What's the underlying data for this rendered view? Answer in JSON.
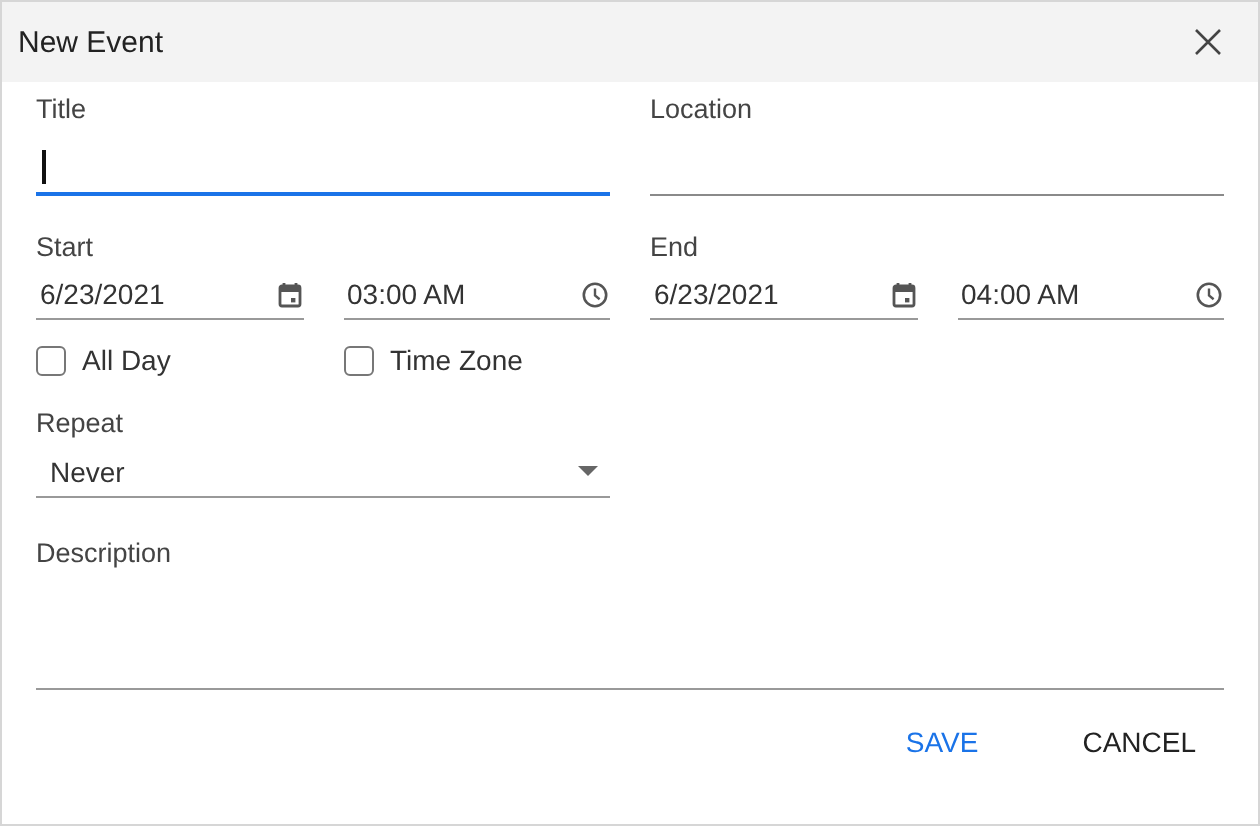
{
  "dialog": {
    "title": "New Event"
  },
  "title_field": {
    "label": "Title",
    "focused": true
  },
  "location_field": {
    "label": "Location",
    "focused": false
  },
  "start": {
    "label": "Start",
    "date": "6/23/2021",
    "time": "03:00 AM"
  },
  "end": {
    "label": "End",
    "date": "6/23/2021",
    "time": "04:00 AM"
  },
  "checkboxes": [
    {
      "label": "All Day",
      "checked": false
    },
    {
      "label": "Time Zone",
      "checked": false
    }
  ],
  "repeat": {
    "label": "Repeat",
    "value": "Never"
  },
  "description": {
    "label": "Description"
  },
  "buttons": [
    {
      "label": "SAVE",
      "kind": "primary"
    },
    {
      "label": "CANCEL",
      "kind": "secondary"
    }
  ]
}
